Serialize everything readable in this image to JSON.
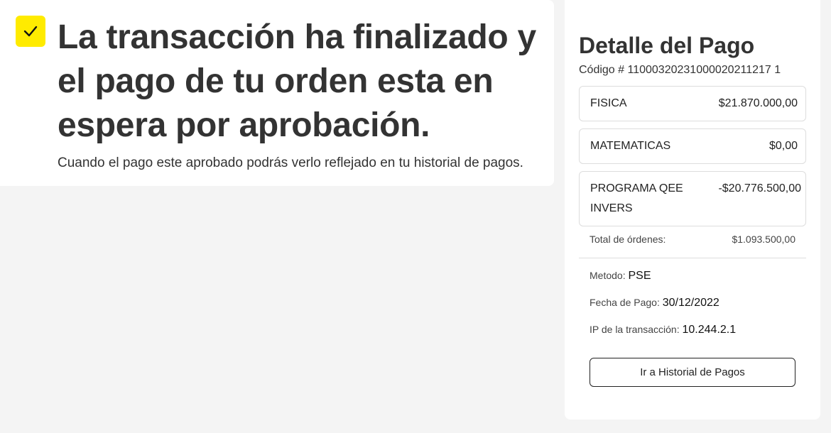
{
  "confirmation": {
    "icon": "check-icon",
    "accent_color": "#ffeb00",
    "headline": "La transacción ha finalizado y el pago de tu orden esta en espera por aprobación.",
    "subtext": "Cuando el pago este aprobado podrás verlo reflejado en tu historial de pagos."
  },
  "payment_detail": {
    "title": "Detalle del Pago",
    "code": "Código # 11000320231000020211217 1",
    "items": [
      {
        "name": "FISICA",
        "amount": "$21.870.000,00"
      },
      {
        "name": "MATEMATICAS",
        "amount": "$0,00"
      },
      {
        "name": "PROGRAMA QEE INVERS",
        "amount": "-$20.776.500,00"
      }
    ],
    "total_label": "Total de órdenes:",
    "total_value": "$1.093.500,00",
    "method_label": "Metodo:",
    "method_value": "PSE",
    "date_label": "Fecha de Pago:",
    "date_value": "30/12/2022",
    "ip_label": "IP de la transacción:",
    "ip_value": "10.244.2.1",
    "history_button": "Ir a Historial de Pagos"
  }
}
